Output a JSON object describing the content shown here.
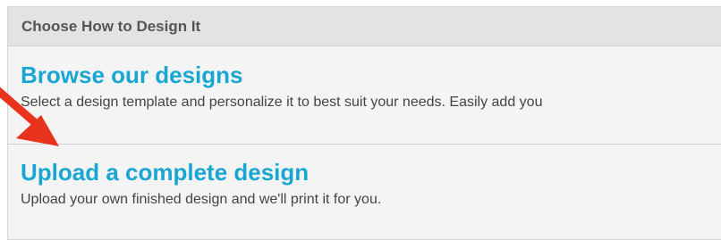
{
  "panel": {
    "title": "Choose How to Design It"
  },
  "options": [
    {
      "title": "Browse our designs",
      "description": "Select a design template and personalize it to best suit your needs. Easily add you"
    },
    {
      "title": "Upload a complete design",
      "description": "Upload your own finished design and we'll print it for you."
    }
  ],
  "annotation": {
    "arrow_color": "#e8341c"
  },
  "colors": {
    "accent": "#1aa6d3",
    "header_bg": "#e3e3e3",
    "panel_bg": "#f4f4f4"
  }
}
